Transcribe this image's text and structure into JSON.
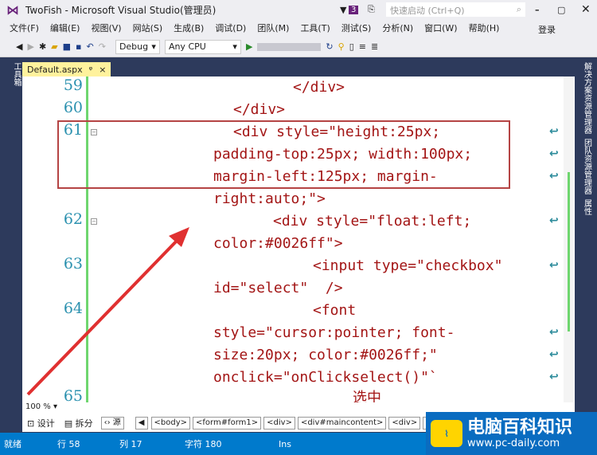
{
  "window": {
    "title": "TwoFish - Microsoft Visual Studio(管理员)",
    "notification_count": "3",
    "quick_launch_placeholder": "快速启动 (Ctrl+Q)"
  },
  "menu": [
    "文件(F)",
    "编辑(E)",
    "视图(V)",
    "网站(S)",
    "生成(B)",
    "调试(D)",
    "团队(M)",
    "工具(T)",
    "测试(S)",
    "分析(N)",
    "窗口(W)",
    "帮助(H)"
  ],
  "signin": "登录",
  "toolbar": {
    "config": "Debug",
    "platform": "Any CPU"
  },
  "doc_tab": {
    "name": "Default.aspx",
    "pin": "ᵠ",
    "close": "×"
  },
  "left_rail": "工具箱",
  "right_rail": [
    "解决方案资源管理器",
    "团队资源管理器",
    "属性"
  ],
  "editor": {
    "line_numbers": [
      "59",
      "60",
      "61",
      "62",
      "63",
      "64",
      "65"
    ],
    "rows": [
      "</div>",
      "</div>",
      "<div style=\"height:25px;",
      "padding-top:25px; width:100px;",
      "margin-left:125px; margin-",
      "right:auto;\">",
      "<div style=\"float:left;",
      "color:#0026ff\">",
      "<input type=\"checkbox\"",
      "id=\"select\"  />",
      "<font",
      "style=\"cursor:pointer; font-",
      "size:20px; color:#0026ff;\"",
      "onclick=\"onClickselect()\"`",
      "选中"
    ]
  },
  "zoom": "100 %",
  "views": {
    "design": "设计",
    "split": "拆分",
    "source": "源"
  },
  "breadcrumb": [
    "<body>",
    "<form#form1>",
    "<div>",
    "<div#maincontent>",
    "<div>",
    "<di"
  ],
  "status": {
    "ready": "就绪",
    "line": "行 58",
    "col": "列 17",
    "char": "字符 180",
    "mode": "Ins"
  },
  "watermark": {
    "name": "电脑百科知识",
    "url": "www.pc-daily.com"
  },
  "colors": {
    "status": "#007acc",
    "highlight_box": "#b54444",
    "arrow": "#e03030"
  }
}
